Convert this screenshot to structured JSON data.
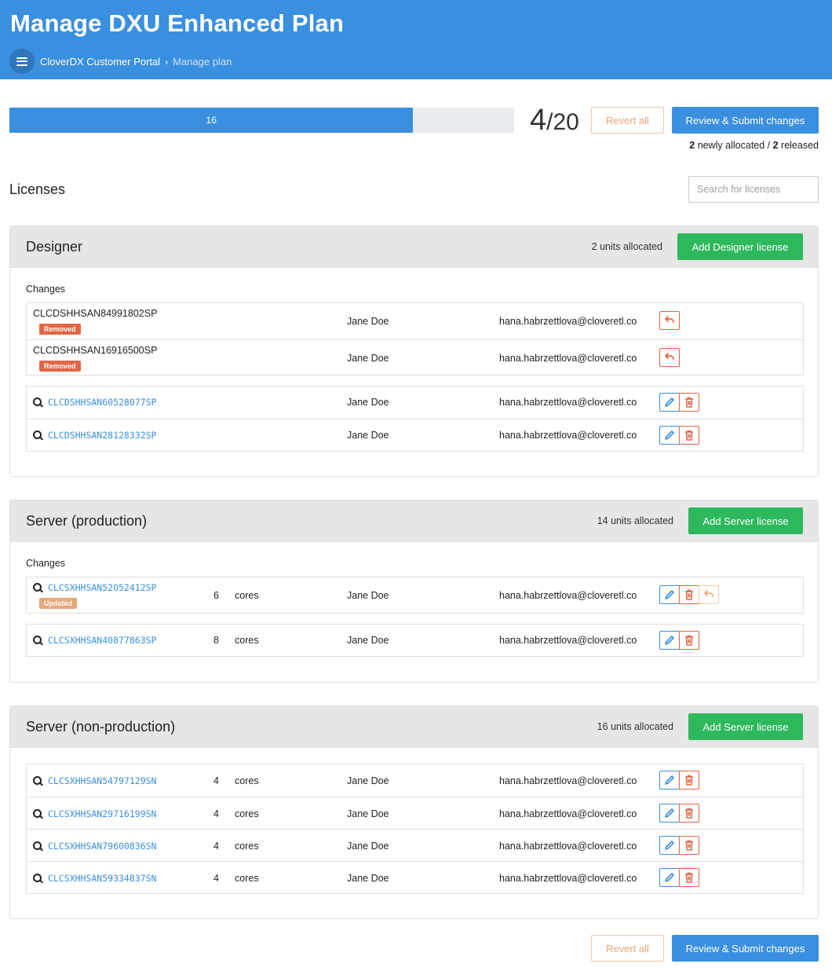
{
  "header": {
    "title": "Manage DXU Enhanced Plan",
    "breadcrumb": [
      "CloverDX Customer Portal",
      "Manage plan"
    ],
    "brand_color": "#3a8fde"
  },
  "allocation": {
    "progress_value": 16,
    "progress_max": 20,
    "progress_label": "16",
    "remaining": "4",
    "slash": "/",
    "total": "20",
    "newly_allocated": "2",
    "newly_allocated_text": " newly allocated / ",
    "released": "2",
    "released_text": " released"
  },
  "actions": {
    "revert_all": "Revert all",
    "review_submit": "Review & Submit changes"
  },
  "licenses": {
    "title": "Licenses",
    "search_placeholder": "Search for licenses"
  },
  "sections": [
    {
      "title": "Designer",
      "units": "2 units allocated",
      "add_label": "Add Designer license",
      "changes_label": "Changes",
      "changes": [
        {
          "id": "CLCDSHHSAN84991802SP",
          "badge": "Removed",
          "owner": "Jane Doe",
          "email": "hana.habrzettlova@cloveretl.com"
        },
        {
          "id": "CLCDSHHSAN16916500SP",
          "badge": "Removed",
          "owner": "Jane Doe",
          "email": "hana.habrzettlova@cloveretl.com"
        }
      ],
      "rows": [
        {
          "id": "CLCDSHHSAN60528077SP",
          "owner": "Jane Doe",
          "email": "hana.habrzettlova@cloveretl.com"
        },
        {
          "id": "CLCDSHHSAN28128332SP",
          "owner": "Jane Doe",
          "email": "hana.habrzettlova@cloveretl.com"
        }
      ]
    },
    {
      "title": "Server (production)",
      "units": "14 units allocated",
      "add_label": "Add Server license",
      "changes_label": "Changes",
      "changes": [
        {
          "id": "CLCSXHHSAN52052412SP",
          "badge": "Updated",
          "cores": "6",
          "cores_label": "cores",
          "owner": "Jane Doe",
          "email": "hana.habrzettlova@cloveretl.com"
        }
      ],
      "rows": [
        {
          "id": "CLCSXHHSAN40877863SP",
          "cores": "8",
          "cores_label": "cores",
          "owner": "Jane Doe",
          "email": "hana.habrzettlova@cloveretl.com"
        }
      ]
    },
    {
      "title": "Server (non-production)",
      "units": "16 units allocated",
      "add_label": "Add Server license",
      "rows": [
        {
          "id": "CLCSXHHSAN54797129SN",
          "cores": "4",
          "cores_label": "cores",
          "owner": "Jane Doe",
          "email": "hana.habrzettlova@cloveretl.com"
        },
        {
          "id": "CLCSXHHSAN29716199SN",
          "cores": "4",
          "cores_label": "cores",
          "owner": "Jane Doe",
          "email": "hana.habrzettlova@cloveretl.com"
        },
        {
          "id": "CLCSXHHSAN79600836SN",
          "cores": "4",
          "cores_label": "cores",
          "owner": "Jane Doe",
          "email": "hana.habrzettlova@cloveretl.com"
        },
        {
          "id": "CLCSXHHSAN59334837SN",
          "cores": "4",
          "cores_label": "cores",
          "owner": "Jane Doe",
          "email": "hana.habrzettlova@cloveretl.com"
        }
      ]
    }
  ],
  "icons": {
    "menu": "hamburger-icon",
    "search": "magnifier-icon",
    "edit": "pencil-icon",
    "delete": "trash-icon",
    "undo": "undo-icon"
  }
}
